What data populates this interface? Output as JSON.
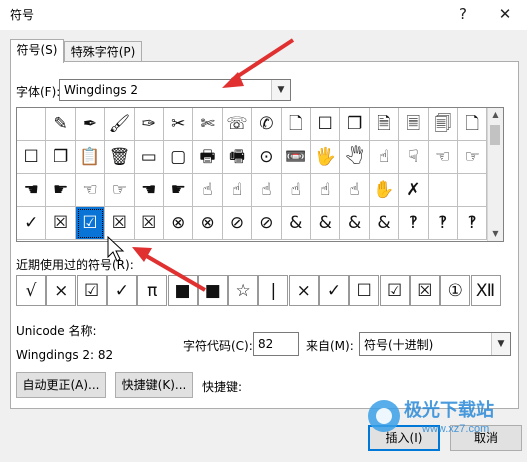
{
  "window": {
    "title": "符号",
    "help_label": "?",
    "close_label": "✕"
  },
  "tabs": [
    {
      "label": "符号(S)"
    },
    {
      "label": "特殊字符(P)"
    }
  ],
  "font": {
    "label": "字体(F):",
    "value": "Wingdings 2"
  },
  "grid": {
    "rows": [
      [
        "",
        "✎",
        "✒",
        "🖌",
        "✑",
        "✂",
        "✄",
        "☏",
        "✆",
        "🗋",
        "☐",
        "❐",
        "🗎",
        "🗏",
        "🗐",
        "🗋"
      ],
      [
        "☐",
        "❐",
        "📋",
        "🗑",
        "▭",
        "▢",
        "🖶",
        "🖷",
        "⊙",
        "📼",
        "🖐",
        "🖑",
        "☝",
        "☟",
        "☜",
        "☞"
      ],
      [
        "☚",
        "☛",
        "☜",
        "☞",
        "☚",
        "☛",
        "☝",
        "☝",
        "☝",
        "☝",
        "☝",
        "☝",
        "✋",
        "✗",
        "",
        ""
      ],
      [
        "✓",
        "☒",
        "☑",
        "☒",
        "☒",
        "⊗",
        "⊗",
        "⊘",
        "⊘",
        "&",
        "&",
        "&",
        "&",
        "‽",
        "‽",
        "‽"
      ]
    ],
    "selected": {
      "row": 3,
      "col": 2
    }
  },
  "recent": {
    "label": "近期使用过的符号(R):",
    "symbols": [
      "√",
      "×",
      "☑",
      "✓",
      "π",
      "■",
      "■",
      "☆",
      "|",
      "×",
      "✓",
      "☐",
      "☑",
      "☒",
      "①",
      "Ⅻ"
    ]
  },
  "unicode": {
    "label": "Unicode 名称:",
    "value": "Wingdings 2: 82"
  },
  "charcode": {
    "label": "字符代码(C):",
    "value": "82"
  },
  "from": {
    "label": "来自(M):",
    "value": "符号(十进制)"
  },
  "buttons": {
    "autocorrect": "自动更正(A)...",
    "shortcut_key": "快捷键(K)...",
    "shortcut_label": "快捷键:",
    "insert": "插入(I)",
    "cancel": "取消"
  },
  "watermark": {
    "text": "极光下载站",
    "url": "www.xz7.com"
  },
  "colors": {
    "selection": "#0a74d6",
    "annotation_arrow": "#e03030",
    "dialog_bg": "#f0f0f0",
    "primary_border": "#0078d7"
  }
}
